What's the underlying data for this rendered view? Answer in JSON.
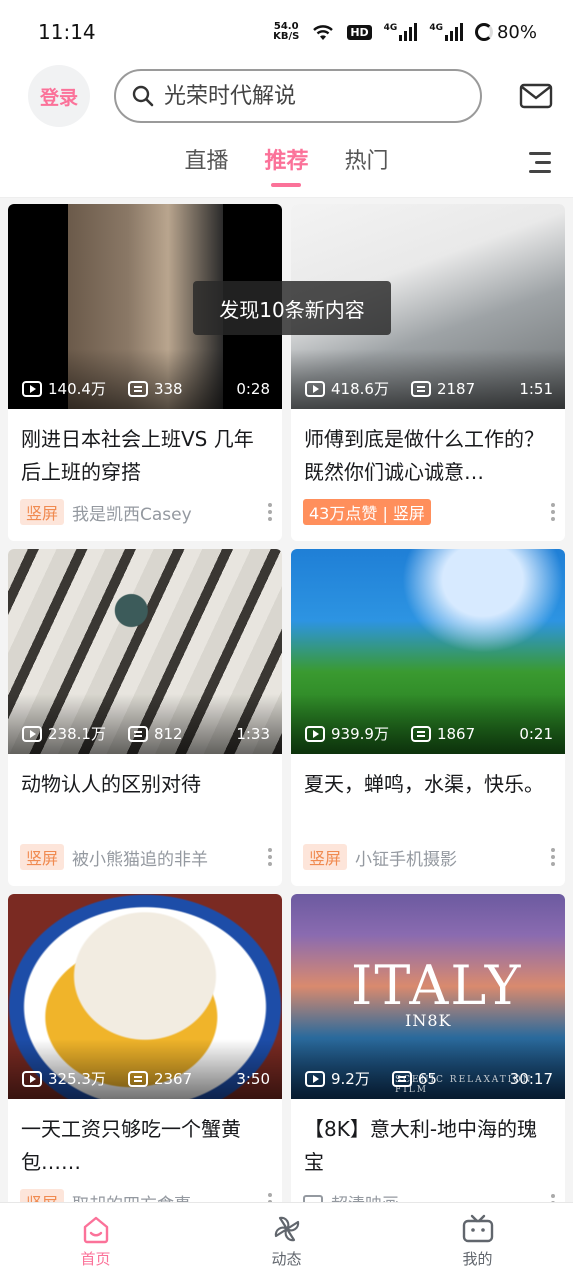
{
  "status_bar": {
    "time": "11:14",
    "net_speed_value": "54.0",
    "net_speed_unit": "KB/S",
    "hd_label": "HD",
    "sim1": "4G",
    "sim2": "4G",
    "battery": "80%"
  },
  "header": {
    "login_label": "登录",
    "search_placeholder": "光荣时代解说",
    "icons": [
      "search-icon",
      "mail-icon"
    ]
  },
  "tabs": [
    {
      "label": "直播",
      "active": false
    },
    {
      "label": "推荐",
      "active": true
    },
    {
      "label": "热门",
      "active": false
    }
  ],
  "toast": "发现10条新内容",
  "cards": [
    {
      "views": "140.4万",
      "danmaku": "338",
      "duration": "0:28",
      "title": "刚进日本社会上班VS 几年后上班的穿搭",
      "badge": "竖屏",
      "author": "我是凯西Casey"
    },
    {
      "views": "418.6万",
      "danmaku": "2187",
      "duration": "1:51",
      "title": "师傅到底是做什么工作的？既然你们诚心诚意…",
      "badge": "43万点赞 | 竖屏",
      "author": ""
    },
    {
      "views": "238.1万",
      "danmaku": "812",
      "duration": "1:33",
      "title": "动物认人的区别对待",
      "badge": "竖屏",
      "author": "被小熊猫追的非羊"
    },
    {
      "views": "939.9万",
      "danmaku": "1867",
      "duration": "0:21",
      "title": "夏天，蝉鸣，水渠，快乐。",
      "badge": "竖屏",
      "author": "小钲手机摄影"
    },
    {
      "views": "325.3万",
      "danmaku": "2367",
      "duration": "3:50",
      "title": "一天工资只够吃一个蟹黄包……",
      "badge": "竖屏",
      "author": "取却的四方食事"
    },
    {
      "views": "9.2万",
      "danmaku": "65",
      "duration": "30:17",
      "title": "【8K】意大利-地中海的瑰宝",
      "badge": "",
      "author": "超清映画",
      "thumb_text": "ITALY",
      "thumb_text_sub": "IN8K",
      "thumb_caption": "SCENIC RELAXATION FILM"
    }
  ],
  "bottom_nav": [
    {
      "label": "首页",
      "icon": "home-icon",
      "active": true
    },
    {
      "label": "动态",
      "icon": "pinwheel-icon",
      "active": false
    },
    {
      "label": "我的",
      "icon": "tv-icon",
      "active": false
    }
  ],
  "colors": {
    "accent": "#fb7299",
    "badge": "#f08a50"
  }
}
